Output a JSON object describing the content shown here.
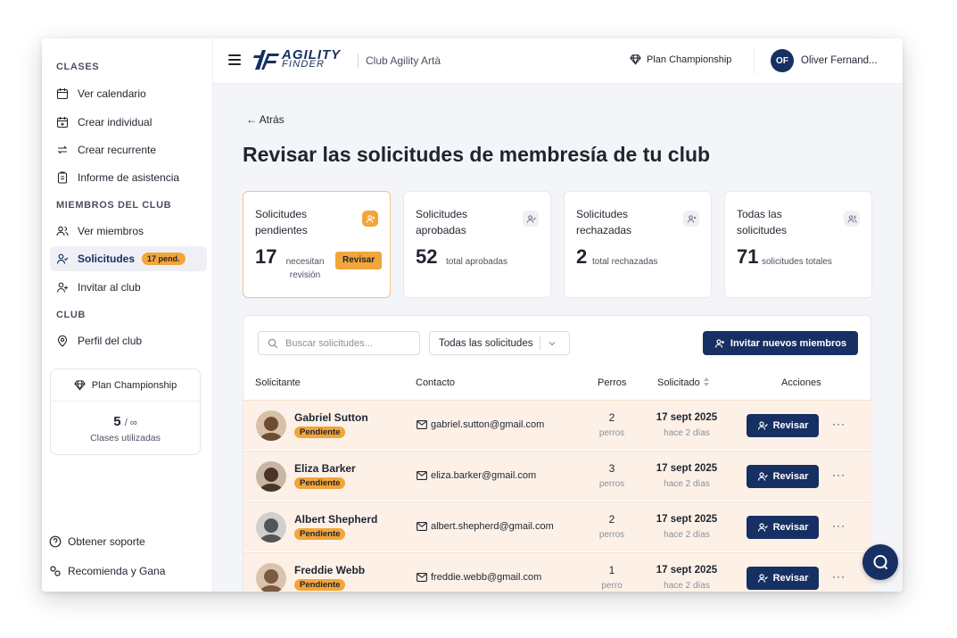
{
  "sidebar": {
    "sections": {
      "classes": "CLASES",
      "members": "MIEMBROS DEL CLUB",
      "club": "CLUB"
    },
    "items": {
      "calendar": "Ver calendario",
      "create_single": "Crear individual",
      "create_recurring": "Crear recurrente",
      "attendance": "Informe de asistencia",
      "members": "Ver miembros",
      "requests": "Solicitudes",
      "requests_badge": "17 pend.",
      "invite": "Invitar al club",
      "profile": "Perfil del club"
    },
    "plan": {
      "name": "Plan Championship",
      "used": "5",
      "limit": "/ ∞",
      "caption": "Clases utilizadas"
    },
    "footer": {
      "support": "Obtener soporte",
      "referral": "Recomienda y Gana"
    }
  },
  "topbar": {
    "logo_line1": "AGILITY",
    "logo_line2": "FINDER",
    "club_name": "Club Agility Artà",
    "plan": "Plan Championship",
    "user_initials": "OF",
    "user_name": "Oliver Fernand..."
  },
  "main": {
    "back": "← Atrás",
    "title": "Revisar las solicitudes de membresía de tu club",
    "stats": [
      {
        "title": "Solicitudes pendientes",
        "value": "17",
        "desc": "necesitan revisión",
        "button": "Revisar"
      },
      {
        "title": "Solicitudes aprobadas",
        "value": "52",
        "desc": "total aprobadas"
      },
      {
        "title": "Solicitudes rechazadas",
        "value": "2",
        "desc": "total rechazadas"
      },
      {
        "title": "Todas las solicitudes",
        "value": "71",
        "desc": "solicitudes totales"
      }
    ],
    "search_placeholder": "Buscar solicitudes...",
    "filter_value": "Todas las solicitudes",
    "invite_button": "Invitar nuevos miembros",
    "columns": {
      "applicant": "Solicitante",
      "contact": "Contacto",
      "dogs": "Perros",
      "requested": "Solicitado",
      "actions": "Acciones"
    },
    "rows": [
      {
        "name": "Gabriel Sutton",
        "status": "Pendiente",
        "email": "gabriel.sutton@gmail.com",
        "dogs": "2",
        "dogs_unit": "perros",
        "date": "17 sept 2025",
        "ago": "hace 2 días",
        "action": "Revisar",
        "more": "···"
      },
      {
        "name": "Eliza Barker",
        "status": "Pendiente",
        "email": "eliza.barker@gmail.com",
        "dogs": "3",
        "dogs_unit": "perros",
        "date": "17 sept 2025",
        "ago": "hace 2 días",
        "action": "Revisar",
        "more": "···"
      },
      {
        "name": "Albert Shepherd",
        "status": "Pendiente",
        "email": "albert.shepherd@gmail.com",
        "dogs": "2",
        "dogs_unit": "perros",
        "date": "17 sept 2025",
        "ago": "hace 2 días",
        "action": "Revisar",
        "more": "···"
      },
      {
        "name": "Freddie Webb",
        "status": "Pendiente",
        "email": "freddie.webb@gmail.com",
        "dogs": "1",
        "dogs_unit": "perro",
        "date": "17 sept 2025",
        "ago": "hace 2 días",
        "action": "Revisar",
        "more": "···"
      }
    ]
  },
  "colors": {
    "brand_navy": "#173063",
    "accent_orange": "#f2a53a",
    "row_highlight": "#fdf1e7"
  }
}
